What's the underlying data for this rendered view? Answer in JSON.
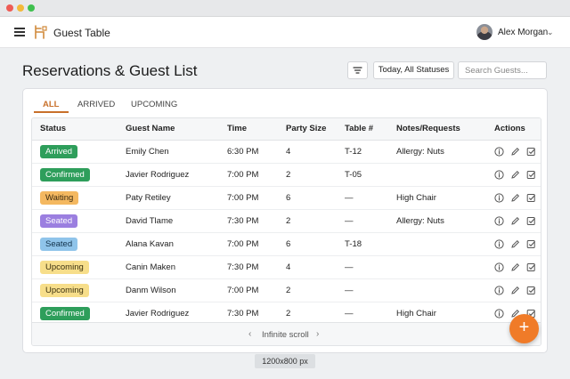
{
  "app": {
    "title": "Guest Table",
    "user_name": "Alex Morgan"
  },
  "page": {
    "title": "Reservations & Guest List"
  },
  "toolbar": {
    "status_filter": "Today, All Statuses",
    "search_placeholder": "Search Guests..."
  },
  "tabs": [
    {
      "label": "ALL",
      "active": true
    },
    {
      "label": "ARRIVED",
      "active": false
    },
    {
      "label": "UPCOMING",
      "active": false
    }
  ],
  "table": {
    "columns": [
      "Status",
      "Guest Name",
      "Time",
      "Party Size",
      "Table #",
      "Notes/Requests",
      "Actions"
    ],
    "rows": [
      {
        "status": "Arrived",
        "name": "Emily Chen",
        "time": "6:30 PM",
        "party": "4",
        "table": "T-12",
        "notes": "Allergy: Nuts"
      },
      {
        "status": "Confirmed",
        "name": "Javier Rodriguez",
        "time": "7:00 PM",
        "party": "2",
        "table": "T-05",
        "notes": ""
      },
      {
        "status": "Waiting",
        "name": "Paty Retiley",
        "time": "7:00 PM",
        "party": "6",
        "table": "—",
        "notes": "High Chair"
      },
      {
        "status": "Seated",
        "name": "David Tlame",
        "time": "7:30 PM",
        "party": "2",
        "table": "—",
        "notes": "Allergy: Nuts"
      },
      {
        "status": "Seated",
        "name": "Alana Kavan",
        "time": "7:00 PM",
        "party": "6",
        "table": "T-18",
        "notes": ""
      },
      {
        "status": "Upcoming",
        "name": "Canin Maken",
        "time": "7:30 PM",
        "party": "4",
        "table": "—",
        "notes": ""
      },
      {
        "status": "Upcoming",
        "name": "Danm Wilson",
        "time": "7:00 PM",
        "party": "2",
        "table": "—",
        "notes": ""
      },
      {
        "status": "Confirmed",
        "name": "Javier Rodriguez",
        "time": "7:30 PM",
        "party": "2",
        "table": "—",
        "notes": "High Chair"
      }
    ],
    "footer_label": "Infinite scroll"
  },
  "status_colors": {
    "Arrived": {
      "bg": "#2e9e5b",
      "fg": "#ffffff"
    },
    "Confirmed": {
      "bg": "#2e9e5b",
      "fg": "#ffffff"
    },
    "Waiting": {
      "bg": "#f4b860",
      "fg": "#3a2a10"
    },
    "Seated": {
      "bg": "#9b7fe0",
      "fg": "#ffffff"
    },
    "Upcoming": {
      "bg": "#f7de8a",
      "fg": "#3a3010"
    },
    "SeatedBlue": {
      "bg": "#8fc4ea",
      "fg": "#12324a"
    }
  },
  "accent": "#c8702a",
  "fab": {
    "label": "+"
  },
  "size_label": "1200x800 px"
}
